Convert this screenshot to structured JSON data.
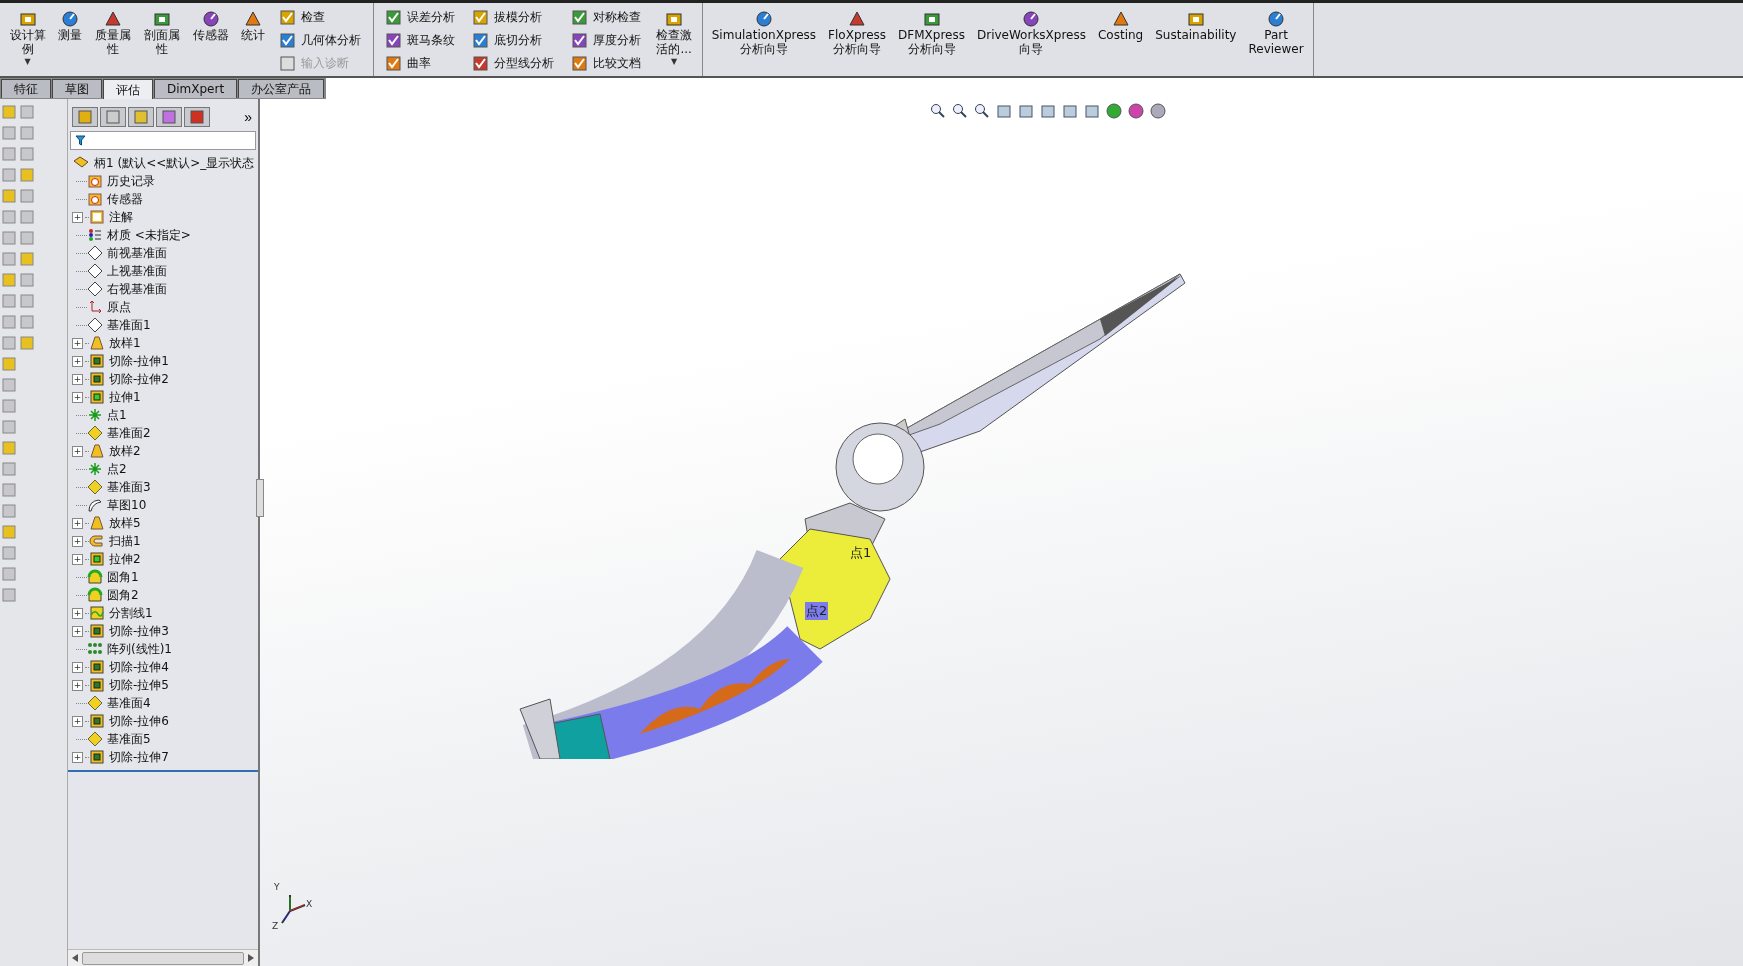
{
  "toolbar": {
    "sections": [
      [
        {
          "kind": "large",
          "label": "设计算例",
          "dropdown": "▼"
        },
        {
          "kind": "large",
          "label": "测量"
        },
        {
          "kind": "large",
          "label": "质量属性"
        },
        {
          "kind": "large",
          "label": "剖面属性"
        },
        {
          "kind": "large",
          "label": "传感器"
        },
        {
          "kind": "large",
          "label": "统计"
        },
        {
          "kind": "column",
          "items": [
            {
              "label": "检查",
              "disabled": false
            },
            {
              "label": "几何体分析",
              "disabled": false
            },
            {
              "label": "输入诊断",
              "disabled": true
            }
          ]
        }
      ],
      [
        {
          "kind": "column",
          "items": [
            {
              "label": "误差分析",
              "disabled": false
            },
            {
              "label": "斑马条纹",
              "disabled": false
            },
            {
              "label": "曲率",
              "disabled": false
            }
          ]
        },
        {
          "kind": "column",
          "items": [
            {
              "label": "拔模分析",
              "disabled": false
            },
            {
              "label": "底切分析",
              "disabled": false
            },
            {
              "label": "分型线分析",
              "disabled": false
            }
          ]
        },
        {
          "kind": "column",
          "items": [
            {
              "label": "对称检查",
              "disabled": false
            },
            {
              "label": "厚度分析",
              "disabled": false
            },
            {
              "label": "比较文档",
              "disabled": false
            }
          ]
        },
        {
          "kind": "large",
          "label": "检查激活的...",
          "dropdown": "▼"
        }
      ],
      [
        {
          "kind": "large",
          "label": "SimulationXpress 分析向导"
        },
        {
          "kind": "large",
          "label": "FloXpress 分析向导"
        },
        {
          "kind": "large",
          "label": "DFMXpress 分析向导"
        },
        {
          "kind": "large",
          "label": "DriveWorksXpress 向导"
        },
        {
          "kind": "large",
          "label": "Costing"
        },
        {
          "kind": "large",
          "label": "Sustainability"
        },
        {
          "kind": "large",
          "label": "Part Reviewer"
        }
      ]
    ]
  },
  "tabs": [
    {
      "label": "特征",
      "selected": false
    },
    {
      "label": "草图",
      "selected": false
    },
    {
      "label": "评估",
      "selected": true
    },
    {
      "label": "DimXpert",
      "selected": false
    },
    {
      "label": "办公室产品",
      "selected": false
    }
  ],
  "tree": {
    "more": "»",
    "root": "柄1  (默认<<默认>_显示状态",
    "items": [
      {
        "label": "历史记录",
        "kind": "history"
      },
      {
        "label": "传感器",
        "kind": "sensor"
      },
      {
        "label": "注解",
        "kind": "annotation",
        "expander": "+"
      },
      {
        "label": "材质 <未指定>",
        "kind": "material"
      },
      {
        "label": "前视基准面",
        "kind": "plane"
      },
      {
        "label": "上视基准面",
        "kind": "plane"
      },
      {
        "label": "右视基准面",
        "kind": "plane"
      },
      {
        "label": "原点",
        "kind": "origin"
      },
      {
        "label": "基准面1",
        "kind": "plane"
      },
      {
        "label": "放样1",
        "kind": "loft",
        "expander": "+"
      },
      {
        "label": "切除-拉伸1",
        "kind": "cut",
        "expander": "+"
      },
      {
        "label": "切除-拉伸2",
        "kind": "cut",
        "expander": "+"
      },
      {
        "label": "拉伸1",
        "kind": "extrude",
        "expander": "+"
      },
      {
        "label": "点1",
        "kind": "point"
      },
      {
        "label": "基准面2",
        "kind": "refplane"
      },
      {
        "label": "放样2",
        "kind": "loft",
        "expander": "+"
      },
      {
        "label": "点2",
        "kind": "point"
      },
      {
        "label": "基准面3",
        "kind": "refplane"
      },
      {
        "label": "草图10",
        "kind": "sketch"
      },
      {
        "label": "放样5",
        "kind": "loft",
        "expander": "+"
      },
      {
        "label": "扫描1",
        "kind": "sweep",
        "expander": "+"
      },
      {
        "label": "拉伸2",
        "kind": "extrude",
        "expander": "+"
      },
      {
        "label": "圆角1",
        "kind": "fillet"
      },
      {
        "label": "圆角2",
        "kind": "fillet"
      },
      {
        "label": "分割线1",
        "kind": "split",
        "expander": "+"
      },
      {
        "label": "切除-拉伸3",
        "kind": "cut",
        "expander": "+"
      },
      {
        "label": "阵列(线性)1",
        "kind": "pattern"
      },
      {
        "label": "切除-拉伸4",
        "kind": "cut",
        "expander": "+"
      },
      {
        "label": "切除-拉伸5",
        "kind": "cut",
        "expander": "+"
      },
      {
        "label": "基准面4",
        "kind": "refplane"
      },
      {
        "label": "切除-拉伸6",
        "kind": "cut",
        "expander": "+"
      },
      {
        "label": "基准面5",
        "kind": "refplane"
      },
      {
        "label": "切除-拉伸7",
        "kind": "cut",
        "expander": "+"
      }
    ]
  },
  "viewport": {
    "points": [
      "点1",
      "点2"
    ],
    "triad": {
      "x": "X",
      "y": "Y",
      "z": "Z"
    }
  }
}
